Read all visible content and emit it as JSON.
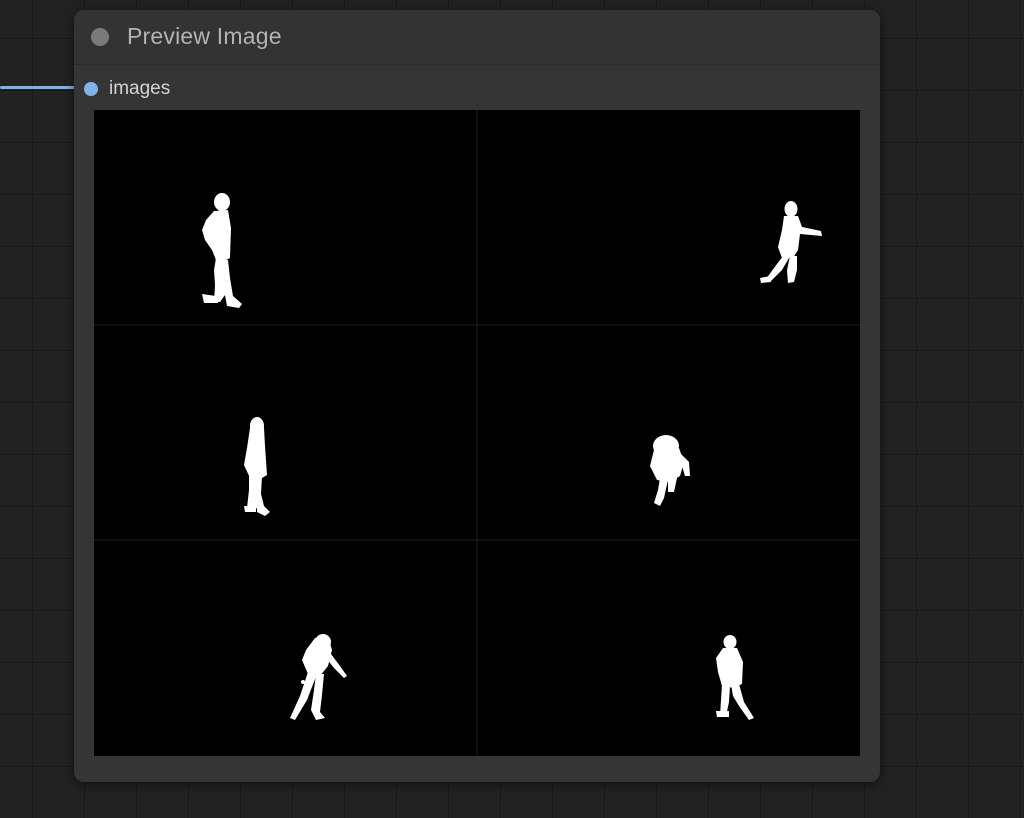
{
  "node": {
    "title": "Preview Image",
    "input": {
      "label": "images",
      "slot_color": "#7fb3ea"
    }
  },
  "preview_grid": {
    "rows": 3,
    "columns": 2,
    "cells": [
      {
        "content": "walking-person-mask"
      },
      {
        "content": "reaching-person-mask"
      },
      {
        "content": "walking-girl-mask"
      },
      {
        "content": "crouching-person-mask"
      },
      {
        "content": "dancing-girl-mask"
      },
      {
        "content": "standing-boy-mask"
      }
    ]
  },
  "colors": {
    "canvas_background": "#222222",
    "node_background": "#353535",
    "link": "#7fb3ea",
    "mask_foreground": "#ffffff",
    "mask_background": "#000000"
  }
}
